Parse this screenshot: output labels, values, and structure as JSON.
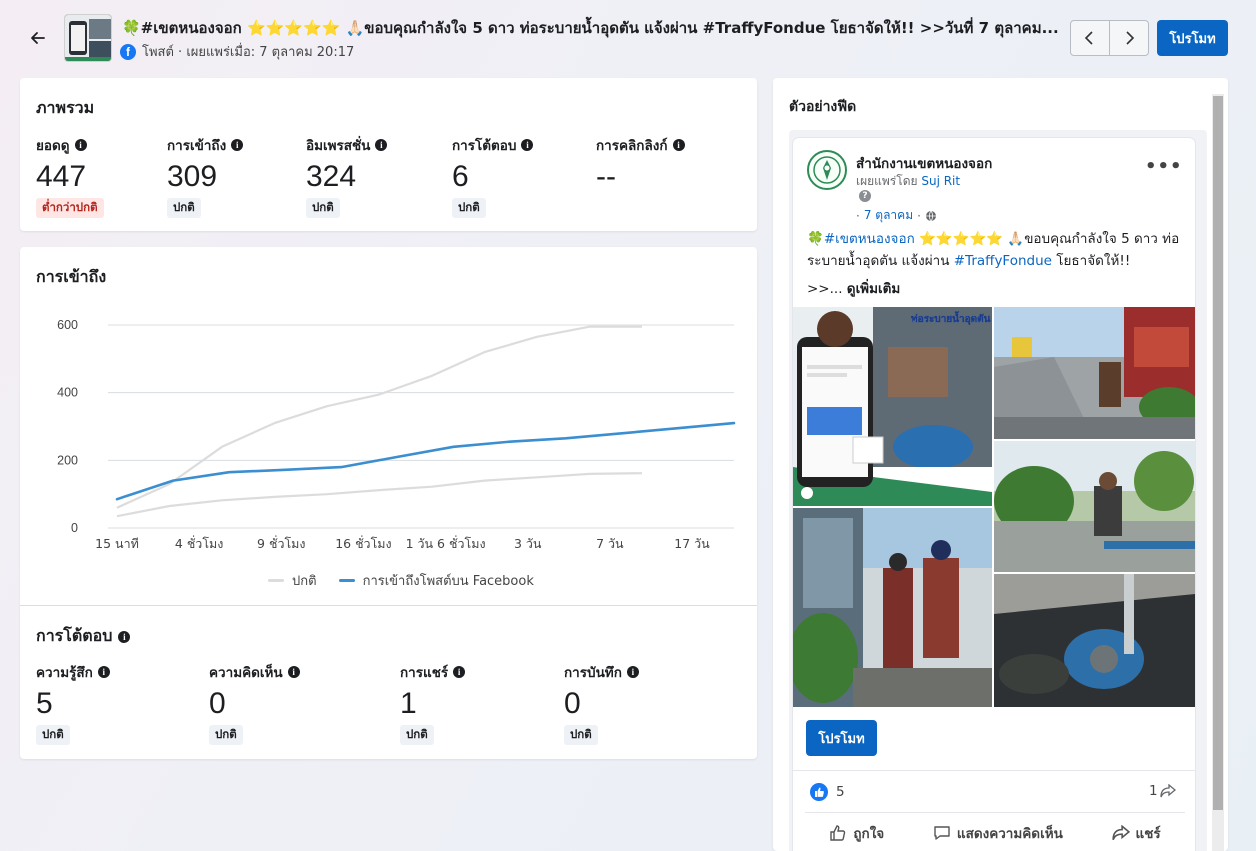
{
  "header": {
    "title": "🍀#เขตหนองจอก ⭐⭐⭐⭐⭐ 🙏🏻ขอบคุณกำลังใจ 5 ดาว ท่อระบายน้ำอุดตัน แจ้งผ่าน #TraffyFondue โยธาจัดให้!! >>วันที่ 7 ตุลาคม...",
    "meta": "โพสต์ · เผยแพร่เมื่อ: 7 ตุลาคม 20:17",
    "promote_label": "โปรโมท"
  },
  "overview": {
    "title": "ภาพรวม",
    "metrics": [
      {
        "label": "ยอดดู",
        "value": "447",
        "badge": "ต่ำกว่าปกติ",
        "low": true
      },
      {
        "label": "การเข้าถึง",
        "value": "309",
        "badge": "ปกติ",
        "low": false
      },
      {
        "label": "อิมเพรสชั่น",
        "value": "324",
        "badge": "ปกติ",
        "low": false
      },
      {
        "label": "การโต้ตอบ",
        "value": "6",
        "badge": "ปกติ",
        "low": false
      },
      {
        "label": "การคลิกลิงก์",
        "value": "--",
        "badge": "",
        "low": false
      }
    ]
  },
  "reach": {
    "title": "การเข้าถึง"
  },
  "chart_data": {
    "type": "line",
    "title": "การเข้าถึง",
    "x": [
      "15 นาที",
      "4 ชั่วโมง",
      "9 ชั่วโมง",
      "16 ชั่วโมง",
      "1 วัน 6 ชั่วโมง",
      "3 วัน",
      "7 วัน",
      "17 วัน"
    ],
    "yticks": [
      0,
      200,
      400,
      600
    ],
    "ylim": [
      0,
      600
    ],
    "grid": true,
    "legend_position": "bottom",
    "series": [
      {
        "name": "ปกติ",
        "color": "#dcdcdc",
        "band_upper": [
          60,
          130,
          240,
          310,
          360,
          395,
          450,
          520,
          565,
          595,
          595
        ],
        "band_lower": [
          35,
          65,
          82,
          92,
          100,
          112,
          122,
          140,
          150,
          160,
          162
        ]
      },
      {
        "name": "การเข้าถึงโพสต์บน Facebook",
        "color": "#3b8ed0",
        "values": [
          85,
          140,
          165,
          172,
          180,
          210,
          240,
          255,
          265,
          280,
          295,
          310
        ]
      }
    ]
  },
  "interactions": {
    "title": "การโต้ตอบ",
    "metrics": [
      {
        "label": "ความรู้สึก",
        "value": "5",
        "badge": "ปกติ"
      },
      {
        "label": "ความคิดเห็น",
        "value": "0",
        "badge": "ปกติ"
      },
      {
        "label": "การแชร์",
        "value": "1",
        "badge": "ปกติ"
      },
      {
        "label": "การบันทึก",
        "value": "0",
        "badge": "ปกติ"
      }
    ]
  },
  "preview": {
    "title": "ตัวอย่างฟีด",
    "page_name": "สำนักงานเขตหนองจอก",
    "published_by_prefix": "เผยแพร่โดย ",
    "published_by_name": "Suj Rit",
    "date": "7 ตุลาคม",
    "post_text_1": "🍀",
    "post_tag_1": "#เขตหนองจอก",
    "post_text_2": " ⭐⭐⭐⭐⭐ 🙏🏻ขอบคุณกำลังใจ 5 ดาว ท่อระบายน้ำอุดตัน แจ้งผ่าน ",
    "post_tag_2": "#TraffyFondue",
    "post_text_3": " โยธาจัดให้!!",
    "see_more_prefix": ">>... ",
    "see_more": "ดูเพิ่มเติม",
    "photo_caption": "ท่อระบายน้ำอุดตัน โยธาจัดให้เต็มที่ !!",
    "promote_label": "โปรโมท",
    "likes": "5",
    "shares": "1",
    "actions": [
      "ถูกใจ",
      "แสดงความคิดเห็น",
      "แชร์"
    ]
  }
}
